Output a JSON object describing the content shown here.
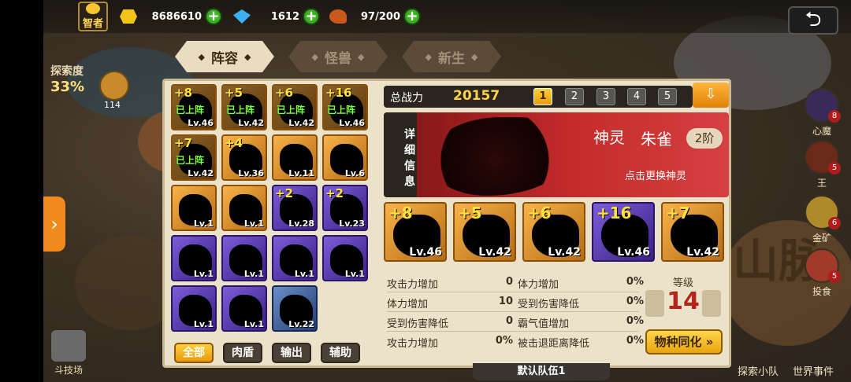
{
  "status": {
    "title": "智者",
    "gold": "8686610",
    "gems": "1612",
    "food": "97/200",
    "plus": "+"
  },
  "left": {
    "explore_label": "探索度",
    "explore_pct": "33%",
    "badge_count": "114",
    "arena_label": "斗技场"
  },
  "right": {
    "items": [
      {
        "label": "心魔",
        "count": "8"
      },
      {
        "label": "王",
        "count": "5"
      },
      {
        "label": "金矿",
        "count": "6"
      },
      {
        "label": "投食",
        "count": "5"
      }
    ],
    "bottom1": "探索小队",
    "bottom2": "世界事件",
    "mountain": "山脉"
  },
  "tabs": [
    "阵容",
    "怪兽",
    "新生"
  ],
  "grid": [
    {
      "star": "+8",
      "lv": "Lv.46",
      "deployed": "已上阵",
      "color": "gold"
    },
    {
      "star": "+5",
      "lv": "Lv.42",
      "deployed": "已上阵",
      "color": "gold"
    },
    {
      "star": "+6",
      "lv": "Lv.42",
      "deployed": "已上阵",
      "color": "gold"
    },
    {
      "star": "+16",
      "lv": "Lv.46",
      "deployed": "已上阵",
      "color": "gold"
    },
    {
      "star": "+7",
      "lv": "Lv.42",
      "deployed": "已上阵",
      "color": "gold"
    },
    {
      "star": "+4",
      "lv": "Lv.36",
      "deployed": "",
      "color": "gold"
    },
    {
      "star": "",
      "lv": "Lv.11",
      "deployed": "",
      "color": "gold"
    },
    {
      "star": "",
      "lv": "Lv.6",
      "deployed": "",
      "color": "gold"
    },
    {
      "star": "",
      "lv": "Lv.1",
      "deployed": "",
      "color": "gold"
    },
    {
      "star": "",
      "lv": "Lv.1",
      "deployed": "",
      "color": "gold"
    },
    {
      "star": "+2",
      "lv": "Lv.28",
      "deployed": "",
      "color": "purple"
    },
    {
      "star": "+2",
      "lv": "Lv.23",
      "deployed": "",
      "color": "purple"
    },
    {
      "star": "",
      "lv": "Lv.1",
      "deployed": "",
      "color": "purple"
    },
    {
      "star": "",
      "lv": "Lv.1",
      "deployed": "",
      "color": "purple"
    },
    {
      "star": "",
      "lv": "Lv.1",
      "deployed": "",
      "color": "purple"
    },
    {
      "star": "",
      "lv": "Lv.1",
      "deployed": "",
      "color": "purple"
    },
    {
      "star": "",
      "lv": "Lv.1",
      "deployed": "",
      "color": "purple"
    },
    {
      "star": "",
      "lv": "Lv.1",
      "deployed": "",
      "color": "purple"
    },
    {
      "star": "",
      "lv": "Lv.22",
      "deployed": "",
      "color": "blue"
    }
  ],
  "filters": [
    "全部",
    "肉盾",
    "输出",
    "辅助"
  ],
  "power": {
    "label": "总战力",
    "value": "20157",
    "slots": [
      "1",
      "2",
      "3",
      "4",
      "5"
    ],
    "active_slot": "1"
  },
  "detail": {
    "tag": "详细信息",
    "spirit": "神灵",
    "name": "朱雀",
    "rank": "2阶",
    "hint": "点击更换神灵"
  },
  "team": [
    {
      "star": "+8",
      "lv": "Lv.46",
      "color": "gold"
    },
    {
      "star": "+5",
      "lv": "Lv.42",
      "color": "gold"
    },
    {
      "star": "+6",
      "lv": "Lv.42",
      "color": "gold"
    },
    {
      "star": "+16",
      "lv": "Lv.46",
      "color": "purple"
    },
    {
      "star": "+7",
      "lv": "Lv.42",
      "color": "gold"
    }
  ],
  "stats": [
    {
      "label": "攻击力增加",
      "value": "0"
    },
    {
      "label": "体力增加",
      "value": "10"
    },
    {
      "label": "受到伤害降低",
      "value": "0"
    },
    {
      "label": "攻击力增加",
      "value": "0%"
    },
    {
      "label": "体力增加",
      "value": "0%"
    },
    {
      "label": "受到伤害降低",
      "value": "0%"
    },
    {
      "label": "霸气值增加",
      "value": "0%"
    },
    {
      "label": "被击退距离降低",
      "value": "0%"
    }
  ],
  "level": {
    "label": "等级",
    "value": "14"
  },
  "sync_button": "物种同化",
  "team_name": "默认队伍1",
  "colors": {
    "accent": "#f0a020",
    "panel": "#ece2c9",
    "detail_red": "#c52b2b"
  }
}
